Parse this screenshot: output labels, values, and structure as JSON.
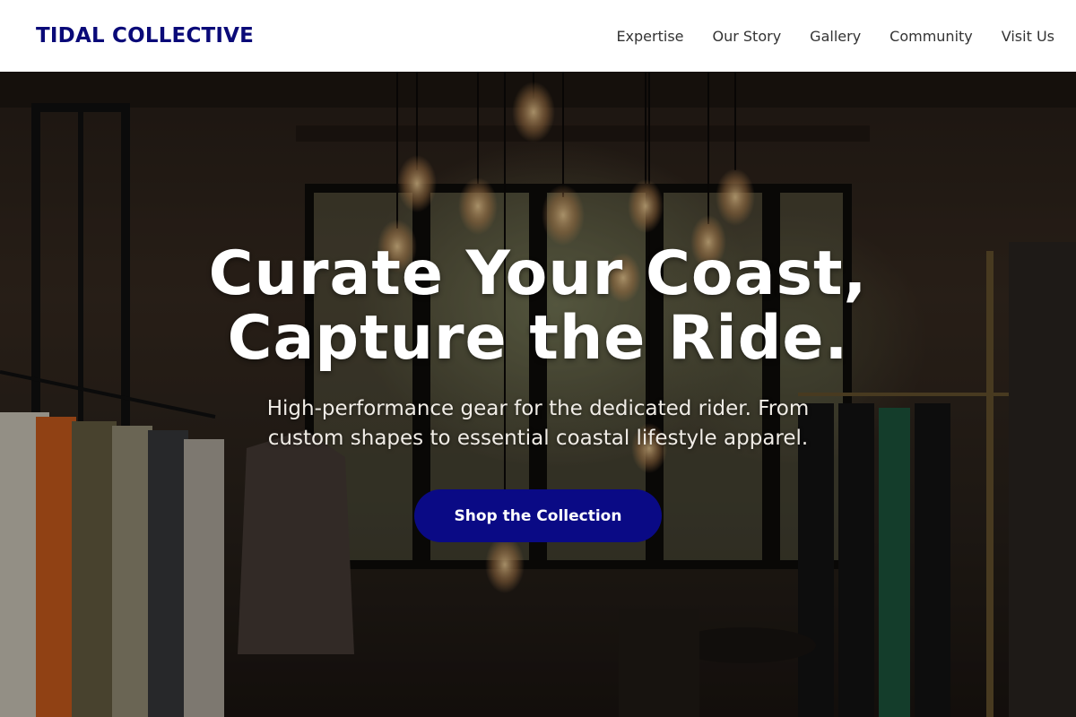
{
  "header": {
    "brand": "TIDAL COLLECTIVE",
    "nav": [
      {
        "label": "Expertise"
      },
      {
        "label": "Our Story"
      },
      {
        "label": "Gallery"
      },
      {
        "label": "Community"
      },
      {
        "label": "Visit Us"
      }
    ]
  },
  "hero": {
    "title_line1": "Curate Your Coast,",
    "title_line2": "Capture the Ride.",
    "subtitle": "High-performance gear for the dedicated rider. From custom shapes to essential coastal lifestyle apparel.",
    "cta_label": "Shop the Collection"
  },
  "colors": {
    "brand": "#0a0a78",
    "cta_background": "#0a0a85",
    "header_background": "#ffffff",
    "nav_text": "#333333"
  }
}
